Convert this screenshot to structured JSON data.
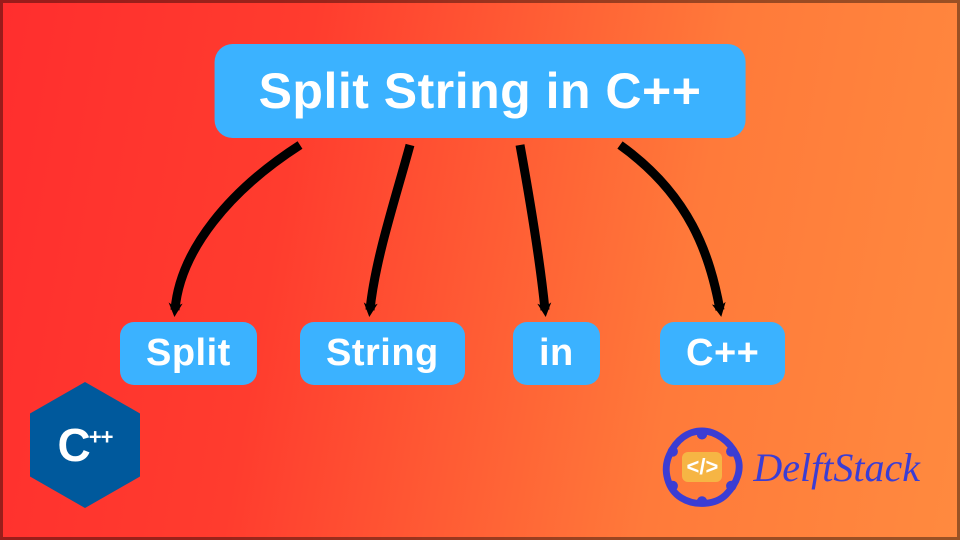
{
  "diagram": {
    "title": "Split String in C++",
    "tokens": [
      "Split",
      "String",
      "in",
      "C++"
    ]
  },
  "logos": {
    "cpp": "C",
    "cpp_plus": "++",
    "delft_code": "</>",
    "delft_label": "DelftStack"
  },
  "colors": {
    "box_bg": "#3bb2ff",
    "box_fg": "#ffffff",
    "arrow": "#000000",
    "grad_left": "#ff2e2e",
    "grad_right": "#ff8a3f",
    "cpp_blue": "#00599c",
    "delft_blue": "#3b3dd4"
  },
  "chart_data": {
    "type": "diagram",
    "description": "One parent node connected by four downward arrows to four child nodes representing the whitespace-split tokens of the parent string.",
    "root": "Split String in C++",
    "children": [
      "Split",
      "String",
      "in",
      "C++"
    ],
    "relation": "string-split-by-whitespace"
  }
}
